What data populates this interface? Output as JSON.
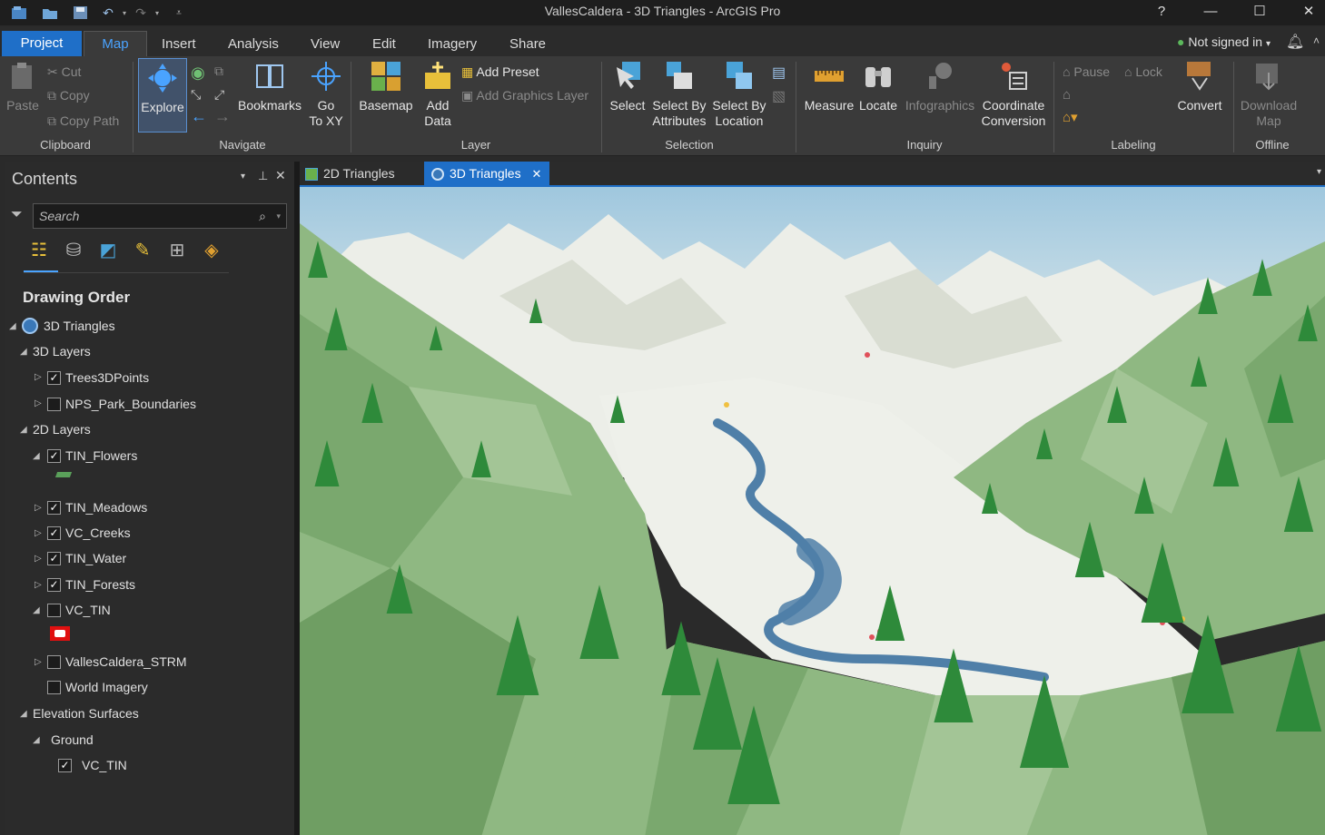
{
  "app": {
    "title": "VallesCaldera - 3D Triangles - ArcGIS Pro"
  },
  "window": {
    "help": "?",
    "minimize": "—",
    "maximize": "☐",
    "close": "✕"
  },
  "ribbon_tabs": [
    "Project",
    "Map",
    "Insert",
    "Analysis",
    "View",
    "Edit",
    "Imagery",
    "Share"
  ],
  "account": {
    "status": "Not signed in",
    "caret": "▾"
  },
  "clipboard": {
    "paste": "Paste",
    "cut": "Cut",
    "copy": "Copy",
    "copy_path": "Copy Path",
    "label": "Clipboard"
  },
  "navigate": {
    "explore": "Explore",
    "bookmarks": "Bookmarks",
    "go_to_xy_1": "Go",
    "go_to_xy_2": "To XY",
    "label": "Navigate"
  },
  "layer": {
    "basemap": "Basemap",
    "add_data_1": "Add",
    "add_data_2": "Data",
    "add_preset": "Add Preset",
    "add_graphics_layer": "Add Graphics Layer",
    "label": "Layer"
  },
  "selection": {
    "select": "Select",
    "select_by_attributes_1": "Select By",
    "select_by_attributes_2": "Attributes",
    "select_by_location_1": "Select By",
    "select_by_location_2": "Location",
    "label": "Selection"
  },
  "inquiry": {
    "measure": "Measure",
    "locate": "Locate",
    "infographics": "Infographics",
    "coord_conv_1": "Coordinate",
    "coord_conv_2": "Conversion",
    "label": "Inquiry"
  },
  "labeling": {
    "pause": "Pause",
    "lock": "Lock",
    "convert": "Convert",
    "label": "Labeling"
  },
  "offline": {
    "download_1": "Download",
    "download_2": "Map",
    "label": "Offline"
  },
  "contents": {
    "title": "Contents",
    "search_placeholder": "Search",
    "drawing_order": "Drawing Order",
    "map_name": "3D Triangles",
    "group_3d": "3D Layers",
    "group_2d": "2D Layers",
    "group_elev": "Elevation Surfaces",
    "ground": "Ground",
    "layers": [
      {
        "name": "Trees3DPoints",
        "checked": true
      },
      {
        "name": "NPS_Park_Boundaries",
        "checked": false
      },
      {
        "name": "TIN_Flowers",
        "checked": true
      },
      {
        "name": "TIN_Meadows",
        "checked": true
      },
      {
        "name": "VC_Creeks",
        "checked": true
      },
      {
        "name": "TIN_Water",
        "checked": true
      },
      {
        "name": "TIN_Forests",
        "checked": true
      },
      {
        "name": "VC_TIN",
        "checked": false
      },
      {
        "name": "VallesCaldera_STRM",
        "checked": false
      },
      {
        "name": "World Imagery",
        "checked": false
      },
      {
        "name": "VC_TIN",
        "checked": true
      }
    ]
  },
  "map_tabs": [
    {
      "label": "2D Triangles"
    },
    {
      "label": "3D Triangles"
    }
  ],
  "colors": {
    "accent": "#1f6fc8",
    "active_tab_text": "#4aa3ff",
    "forest": "#7fae73",
    "snow": "#eef0ea",
    "water": "#4f7fa8",
    "tree": "#2e8a3a",
    "sky": "#bcd6e4"
  }
}
